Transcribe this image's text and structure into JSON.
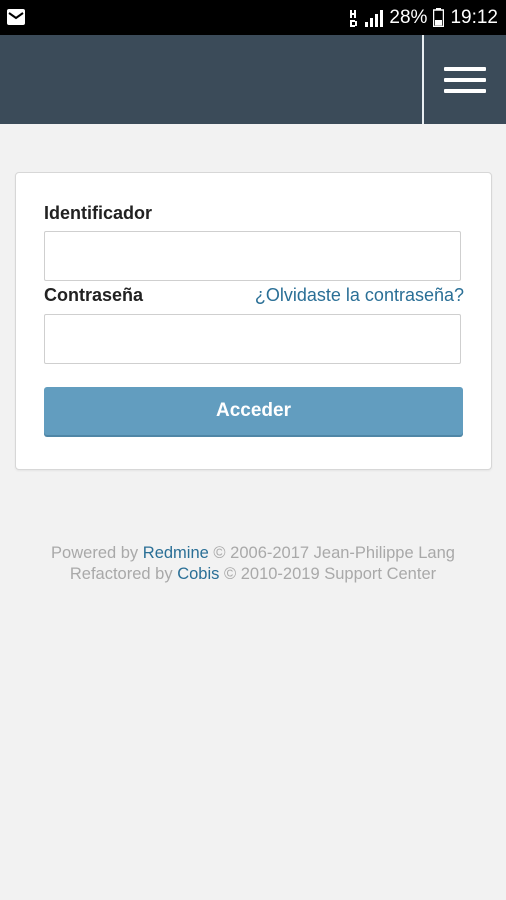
{
  "status_bar": {
    "battery_percent": "28%",
    "time": "19:12",
    "icons": [
      "mail-icon",
      "hd-icon",
      "signal-icon",
      "battery-icon"
    ]
  },
  "header": {
    "menu_icon": "hamburger-menu-icon"
  },
  "login_form": {
    "username_label": "Identificador",
    "username_value": "",
    "password_label": "Contraseña",
    "password_value": "",
    "forgot_link": "¿Olvidaste la contraseña?",
    "submit_label": "Acceder"
  },
  "footer": {
    "line1_prefix": "Powered by",
    "line1_link": "Redmine",
    "line1_suffix": "© 2006-2017 Jean-Philippe Lang",
    "line2_prefix": "Refactored by",
    "line2_link": "Cobis",
    "line2_suffix": "© 2010-2019 Support Center"
  },
  "colors": {
    "header": "#3b4b59",
    "button": "#629dbf",
    "link": "#2a6f96",
    "background": "#f2f2f2"
  }
}
